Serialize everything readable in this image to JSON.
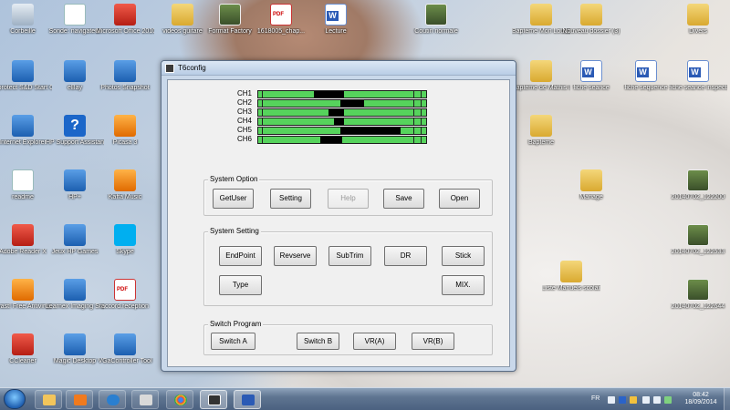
{
  "desktop_icons": [
    {
      "label": "Corbeille",
      "type": "trash"
    },
    {
      "label": "Sonde: navigateur",
      "type": "doc"
    },
    {
      "label": "Microsoft Office 2010",
      "type": "red"
    },
    {
      "label": "videos guitare",
      "type": "folder"
    },
    {
      "label": "Format Factory",
      "type": "photo"
    },
    {
      "label": "1618005_chap...",
      "type": "pdf"
    },
    {
      "label": "Lecture",
      "type": "word"
    },
    {
      "label": "Coutin normale",
      "type": "photo"
    },
    {
      "label": "Baptême Mon Louisa, 7 mai...",
      "type": "folder"
    },
    {
      "label": "Nouveau dossier (3)",
      "type": "folder"
    },
    {
      "label": "Divers",
      "type": "folder"
    },
    {
      "label": "Sprotect S&D Start Center",
      "type": "app"
    },
    {
      "label": "eBay",
      "type": "app"
    },
    {
      "label": "Photos Snapshot",
      "type": "app"
    },
    {
      "label": "Baptême de Mathis le ...",
      "type": "folder"
    },
    {
      "label": "fiche seance",
      "type": "word"
    },
    {
      "label": "fiche sequence",
      "type": "word"
    },
    {
      "label": "fiche seance inspection",
      "type": "word"
    },
    {
      "label": "Internet Explorer",
      "type": "app"
    },
    {
      "label": "HP Support Assistant",
      "type": "help"
    },
    {
      "label": "Picasa 3",
      "type": "orange"
    },
    {
      "label": "Baptême",
      "type": "folder"
    },
    {
      "label": "readme",
      "type": "doc"
    },
    {
      "label": "HP+",
      "type": "app"
    },
    {
      "label": "Kaffa Music",
      "type": "orange"
    },
    {
      "label": "Mariage",
      "type": "folder"
    },
    {
      "label": "20140702_122200",
      "type": "photo"
    },
    {
      "label": "Adobe Reader X",
      "type": "red"
    },
    {
      "label": "Jeux HP Games",
      "type": "app"
    },
    {
      "label": "Skype",
      "type": "skype"
    },
    {
      "label": "20140702_122533",
      "type": "photo"
    },
    {
      "label": "avast! Free Antivirus",
      "type": "orange"
    },
    {
      "label": "Learnex Imaging Studi...",
      "type": "app"
    },
    {
      "label": "accord.reception",
      "type": "pdf"
    },
    {
      "label": "Liste Manuels scolaires",
      "type": "folder"
    },
    {
      "label": "20140702_122644",
      "type": "photo"
    },
    {
      "label": "CCleaner",
      "type": "red"
    },
    {
      "label": "Magic Desktop",
      "type": "app"
    },
    {
      "label": "VGaController Tool",
      "type": "app"
    }
  ],
  "window": {
    "title": "T6config",
    "channels": [
      {
        "label": "CH1",
        "start": 0.33,
        "end": 0.51
      },
      {
        "label": "CH2",
        "start": 0.49,
        "end": 0.63
      },
      {
        "label": "CH3",
        "start": 0.42,
        "end": 0.51
      },
      {
        "label": "CH4",
        "start": 0.45,
        "end": 0.51
      },
      {
        "label": "CH5",
        "start": 0.49,
        "end": 0.85
      },
      {
        "label": "CH6",
        "start": 0.37,
        "end": 0.5
      }
    ],
    "system_option": {
      "title": "System Option",
      "buttons": [
        {
          "label": "GetUser",
          "enabled": true
        },
        {
          "label": "Setting",
          "enabled": true
        },
        {
          "label": "Help",
          "enabled": false
        },
        {
          "label": "Save",
          "enabled": true
        },
        {
          "label": "Open",
          "enabled": true
        }
      ]
    },
    "system_setting": {
      "title": "System Setting",
      "buttons": [
        "EndPoint",
        "Revserve",
        "SubTrim",
        "DR",
        "Stick",
        "Type",
        "MIX."
      ]
    },
    "switch_program": {
      "title": "Switch Program",
      "buttons": [
        "Switch A",
        "Switch B",
        "VR(A)",
        "VR(B)"
      ]
    }
  },
  "taskbar": {
    "lang": "FR",
    "time": "08:42",
    "date": "18/09/2014"
  }
}
